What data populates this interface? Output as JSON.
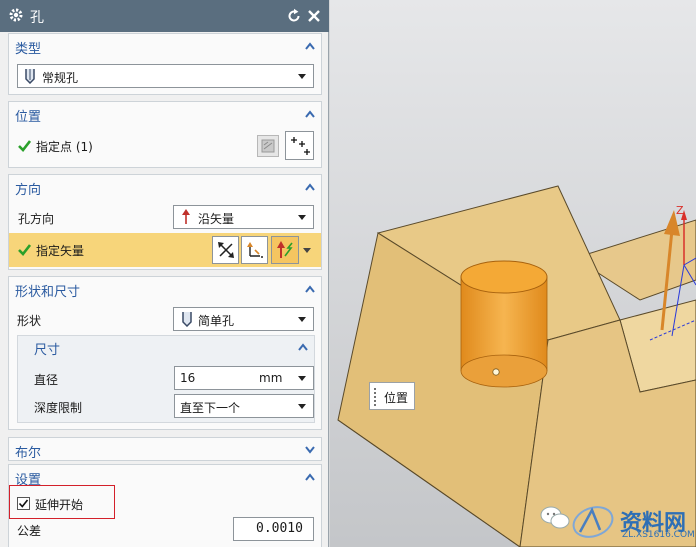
{
  "dialog": {
    "title": "孔",
    "type_section": {
      "title": "类型",
      "combo_value": "常规孔"
    },
    "position_section": {
      "title": "位置",
      "point_label": "指定点 (1)"
    },
    "direction_section": {
      "title": "方向",
      "hole_dir_label": "孔方向",
      "hole_dir_value": "沿矢量",
      "vector_label": "指定矢量"
    },
    "shape_section": {
      "title": "形状和尺寸",
      "shape_label": "形状",
      "shape_value": "简单孔",
      "dims": {
        "title": "尺寸",
        "diameter_label": "直径",
        "diameter_value": "16",
        "diameter_unit": "mm",
        "depth_label": "深度限制",
        "depth_value": "直至下一个"
      }
    },
    "boolean_section": {
      "title": "布尔"
    },
    "settings_section": {
      "title": "设置",
      "extend_start_label": "延伸开始",
      "extend_start_checked": true,
      "tolerance_label": "公差",
      "tolerance_value": "0.0010"
    }
  },
  "viewport": {
    "position_tag": "位置",
    "axis_label": "Z"
  },
  "watermark": {
    "text": "资料网",
    "subtext": "ZL.XS1616.COM"
  },
  "colors": {
    "titlebar": "#5a6e7f",
    "section_title": "#2a5aa0",
    "highlight_row": "#f7d57a",
    "check_green": "#2aa02a",
    "solid_face": "#e8c987",
    "cylinder": "#f2a530",
    "vector_arrow": "#d8862a"
  }
}
